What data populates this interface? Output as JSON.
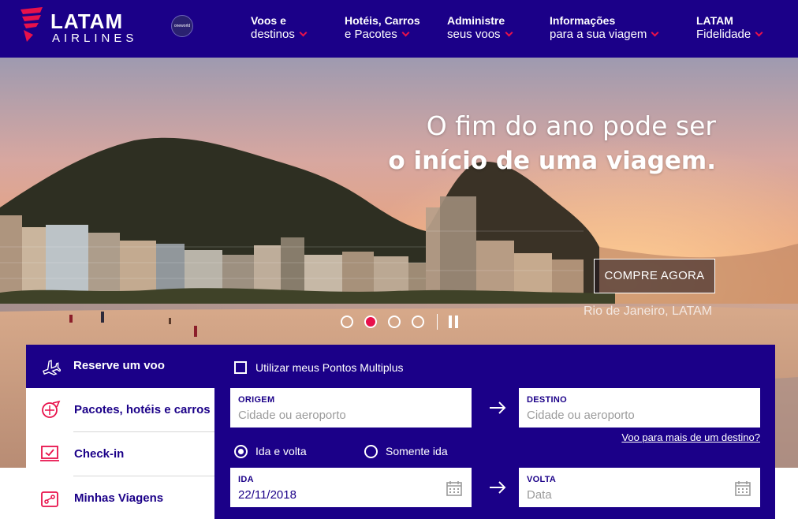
{
  "brand": {
    "name": "LATAM",
    "sub": "AIRLINES",
    "alliance": "oneworld"
  },
  "nav": [
    {
      "line1": "Voos e",
      "line2": "destinos"
    },
    {
      "line1": "Hotéis, Carros",
      "line2": "e Pacotes"
    },
    {
      "line1": "Administre",
      "line2": "seus voos"
    },
    {
      "line1": "Informações",
      "line2": "para a sua viagem"
    },
    {
      "line1": "LATAM",
      "line2": "Fidelidade"
    }
  ],
  "hero": {
    "title_line1": "O fim do ano pode ser",
    "title_line2": "o início de uma viagem.",
    "cta": "COMPRE AGORA",
    "caption": "Rio de Janeiro, LATAM",
    "slides_total": 4,
    "active_slide": 2
  },
  "booking": {
    "tabs": [
      {
        "label": "Reserve um voo",
        "icon": "airplane-icon",
        "active": true
      },
      {
        "label": "Pacotes, hotéis e carros",
        "icon": "package-icon"
      },
      {
        "label": "Check-in",
        "icon": "checkin-icon"
      },
      {
        "label": "Minhas Viagens",
        "icon": "trips-icon"
      }
    ],
    "points_label": "Utilizar meus Pontos Multiplus",
    "origin": {
      "label": "ORIGEM",
      "placeholder": "Cidade ou aeroporto"
    },
    "destination": {
      "label": "DESTINO",
      "placeholder": "Cidade ou aeroporto"
    },
    "multi_link": "Voo para mais de um destino?",
    "trip_types": [
      {
        "label": "Ida e volta",
        "selected": true
      },
      {
        "label": "Somente ida",
        "selected": false
      }
    ],
    "depart": {
      "label": "IDA",
      "value": "22/11/2018"
    },
    "return": {
      "label": "VOLTA",
      "placeholder": "Data"
    }
  },
  "colors": {
    "primary": "#1b0088",
    "accent": "#e8114b"
  }
}
